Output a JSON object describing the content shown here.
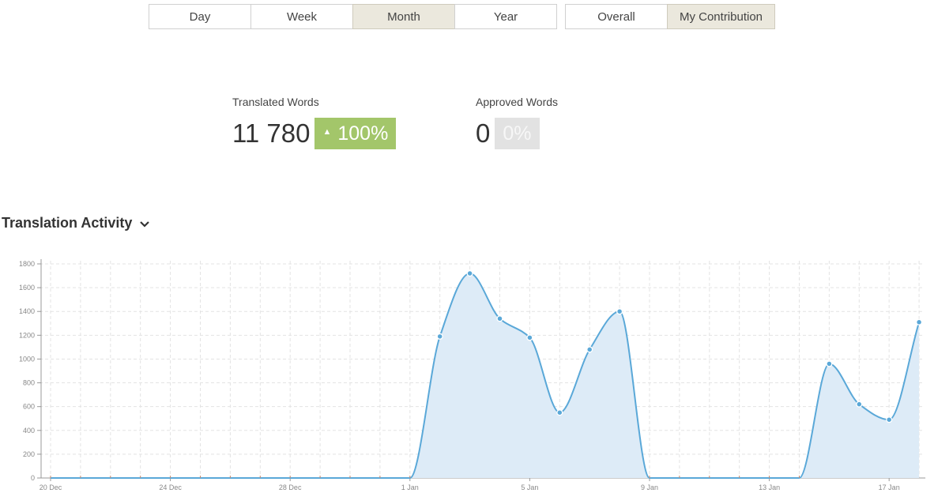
{
  "period_tabs": [
    {
      "label": "Day",
      "active": false
    },
    {
      "label": "Week",
      "active": false
    },
    {
      "label": "Month",
      "active": true
    },
    {
      "label": "Year",
      "active": false
    }
  ],
  "scope_tabs": [
    {
      "label": "Overall",
      "active": false
    },
    {
      "label": "My Contribution",
      "active": true
    }
  ],
  "stats": {
    "translated": {
      "label": "Translated Words",
      "value": "11 780",
      "change": "100%",
      "trend": "up",
      "color": "#a3c66a"
    },
    "approved": {
      "label": "Approved Words",
      "value": "0",
      "change": "0%",
      "color": "#e2e2e2"
    }
  },
  "activity": {
    "title": "Translation Activity",
    "chevron_icon": "chevron-down-icon"
  },
  "chart_data": {
    "type": "area",
    "x_tick_labels": [
      "20 Dec",
      "24 Dec",
      "28 Dec",
      "1 Jan",
      "5 Jan",
      "9 Jan",
      "13 Jan",
      "17 Jan"
    ],
    "y_tick_labels": [
      "0",
      "200",
      "400",
      "600",
      "800",
      "1000",
      "1200",
      "1400",
      "1600",
      "1800"
    ],
    "ylim": [
      0,
      1800
    ],
    "grid": true,
    "line_color": "#5aa8d8",
    "fill_color": "#ddebf7",
    "zero_marker_color": "#c9896a",
    "days": [
      "20 Dec",
      "21 Dec",
      "22 Dec",
      "23 Dec",
      "24 Dec",
      "25 Dec",
      "26 Dec",
      "27 Dec",
      "28 Dec",
      "29 Dec",
      "30 Dec",
      "31 Dec",
      "1 Jan",
      "2 Jan",
      "3 Jan",
      "4 Jan",
      "5 Jan",
      "6 Jan",
      "7 Jan",
      "8 Jan",
      "9 Jan",
      "10 Jan",
      "11 Jan",
      "12 Jan",
      "13 Jan",
      "14 Jan",
      "15 Jan",
      "16 Jan",
      "17 Jan",
      "18 Jan"
    ],
    "values": [
      0,
      0,
      0,
      0,
      0,
      0,
      0,
      0,
      0,
      0,
      0,
      0,
      0,
      1190,
      1720,
      1340,
      1180,
      550,
      1080,
      1400,
      0,
      0,
      0,
      0,
      0,
      0,
      960,
      620,
      490,
      1310
    ]
  }
}
